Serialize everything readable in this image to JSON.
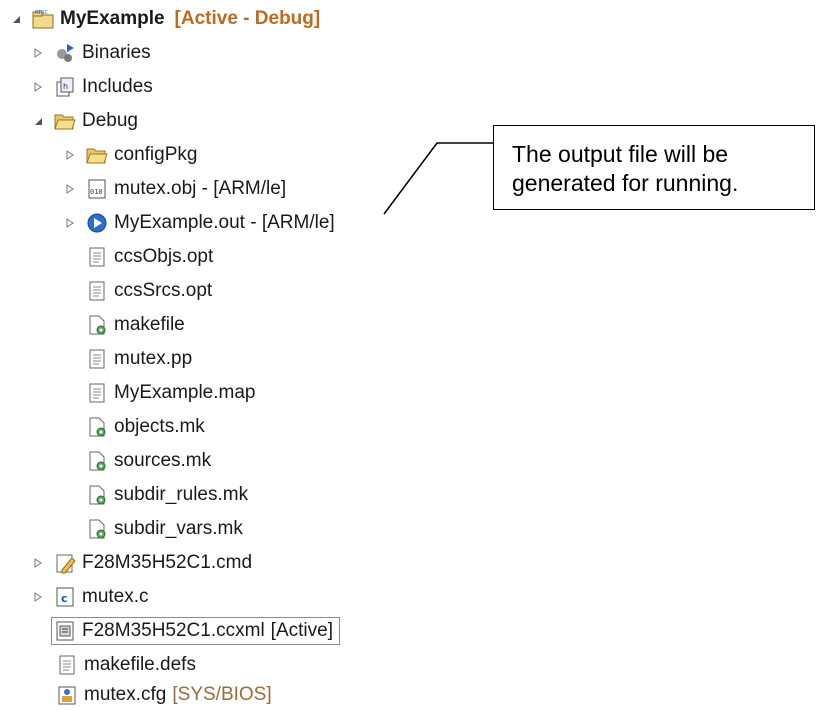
{
  "project": {
    "name": "MyExample",
    "decoration": "[Active - Debug]"
  },
  "items": [
    {
      "label": "Binaries",
      "icon": "binaries-icon"
    },
    {
      "label": "Includes",
      "icon": "includes-icon"
    },
    {
      "label": "Debug",
      "icon": "folder-open-icon"
    },
    {
      "label": "configPkg",
      "icon": "folder-icon"
    },
    {
      "label": "mutex.obj - [ARM/le]",
      "icon": "object-file-icon"
    },
    {
      "label": "MyExample.out - [ARM/le]",
      "icon": "executable-icon"
    },
    {
      "label": "ccsObjs.opt",
      "icon": "text-file-icon"
    },
    {
      "label": "ccsSrcs.opt",
      "icon": "text-file-icon"
    },
    {
      "label": "makefile",
      "icon": "makefile-icon"
    },
    {
      "label": "mutex.pp",
      "icon": "text-file-icon"
    },
    {
      "label": "MyExample.map",
      "icon": "text-file-icon"
    },
    {
      "label": "objects.mk",
      "icon": "makefile-icon"
    },
    {
      "label": "sources.mk",
      "icon": "makefile-icon"
    },
    {
      "label": "subdir_rules.mk",
      "icon": "makefile-icon"
    },
    {
      "label": "subdir_vars.mk",
      "icon": "makefile-icon"
    },
    {
      "label": "F28M35H52C1.cmd",
      "icon": "linker-cmd-icon"
    },
    {
      "label": "mutex.c",
      "icon": "c-source-icon"
    },
    {
      "label": "F28M35H52C1.ccxml",
      "decoration": "[Active]",
      "icon": "target-config-icon"
    },
    {
      "label": "makefile.defs",
      "icon": "text-file-icon"
    },
    {
      "label": "mutex.cfg",
      "decoration": "[SYS/BIOS]",
      "icon": "rtsc-config-icon"
    }
  ],
  "callout": {
    "text": "The output file will be generated for running."
  }
}
